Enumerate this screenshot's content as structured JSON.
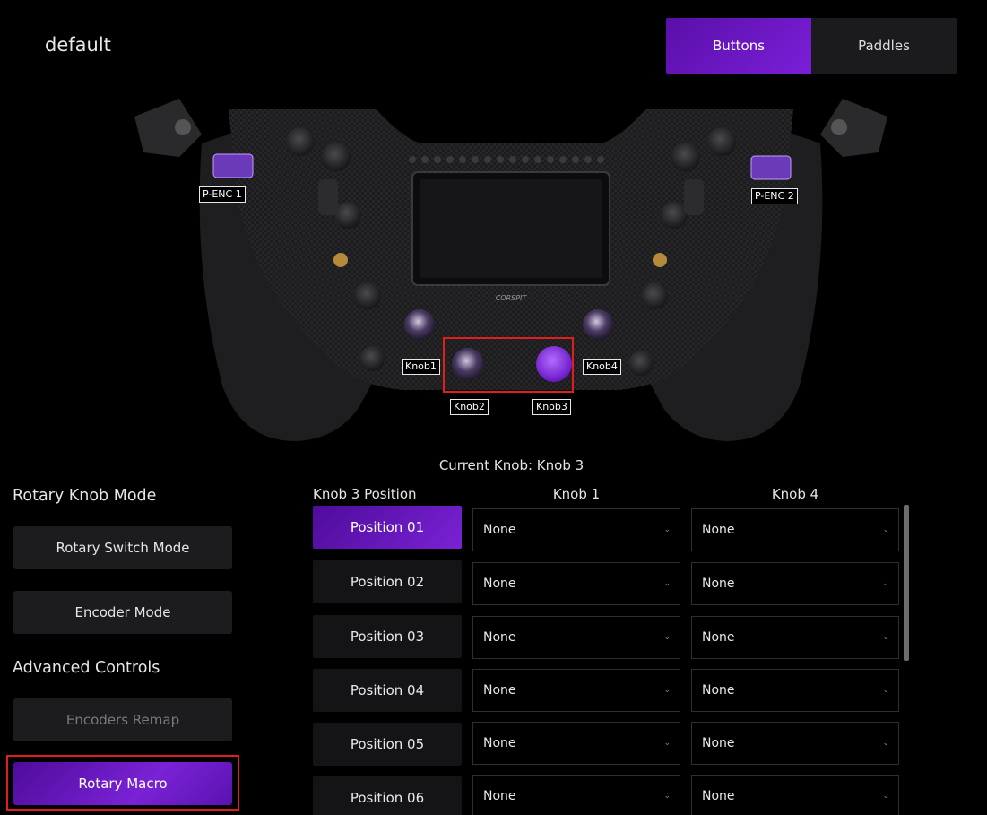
{
  "header": {
    "profile_name": "default"
  },
  "view_toggle": {
    "buttons_label": "Buttons",
    "paddles_label": "Paddles",
    "active": "Buttons"
  },
  "wheel": {
    "brand_text": "CORSPIT",
    "labels": {
      "penc1": "P-ENC 1",
      "penc2": "P-ENC 2",
      "knob1": "Knob1",
      "knob2": "Knob2",
      "knob3": "Knob3",
      "knob4": "Knob4"
    }
  },
  "current_knob_text": "Current Knob: Knob 3",
  "sidebar": {
    "rotary_mode_title": "Rotary Knob Mode",
    "rotary_switch_label": "Rotary Switch Mode",
    "encoder_mode_label": "Encoder Mode",
    "advanced_title": "Advanced Controls",
    "encoders_remap_label": "Encoders Remap",
    "rotary_macro_label": "Rotary Macro"
  },
  "table": {
    "headers": {
      "position": "Knob 3 Position",
      "col1": "Knob 1",
      "col2": "Knob 4"
    },
    "rows": [
      {
        "label": "Position 01",
        "knob1": "None",
        "knob4": "None"
      },
      {
        "label": "Position 02",
        "knob1": "None",
        "knob4": "None"
      },
      {
        "label": "Position 03",
        "knob1": "None",
        "knob4": "None"
      },
      {
        "label": "Position 04",
        "knob1": "None",
        "knob4": "None"
      },
      {
        "label": "Position 05",
        "knob1": "None",
        "knob4": "None"
      },
      {
        "label": "Position 06",
        "knob1": "None",
        "knob4": "None"
      }
    ],
    "active_row": 0
  },
  "colors": {
    "accent": "#6a16c4",
    "highlight": "#e21d1d",
    "panel": "#1c1c1e"
  }
}
